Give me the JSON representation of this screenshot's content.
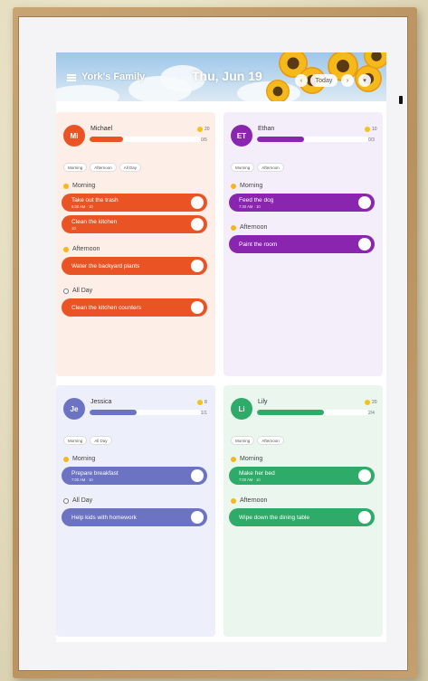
{
  "header": {
    "family_name": "York's Family",
    "date": "Thu, Jun 19",
    "today_label": "Today",
    "prev_icon": "chevron-left-icon",
    "next_icon": "chevron-right-icon",
    "filter_icon": "filter-icon",
    "menu_icon": "menu-icon"
  },
  "members": [
    {
      "initials": "Mi",
      "name": "Michael",
      "color": "#ea5424",
      "bg": "#fdeee8",
      "progress": 0.3,
      "stars": "20",
      "ratio": "0/5",
      "chips": [
        "Morning",
        "Afternoon",
        "All Day"
      ],
      "sections": [
        {
          "label": "Morning",
          "icon": "sun-icon",
          "tasks": [
            {
              "title": "Take out the trash",
              "meta": "6:00 AM  ·  10"
            },
            {
              "title": "Clean the kitchen",
              "meta": "10"
            }
          ]
        },
        {
          "label": "Afternoon",
          "icon": "sun-icon",
          "tasks": [
            {
              "title": "Water the backyard plants",
              "meta": ""
            }
          ]
        },
        {
          "label": "All Day",
          "icon": "clock-icon",
          "tasks": [
            {
              "title": "Clean the kitchen counters",
              "meta": ""
            }
          ]
        }
      ]
    },
    {
      "initials": "ET",
      "name": "Ethan",
      "color": "#8a25b0",
      "bg": "#f4eefb",
      "progress": 0.42,
      "stars": "10",
      "ratio": "0/3",
      "chips": [
        "Morning",
        "Afternoon"
      ],
      "sections": [
        {
          "label": "Morning",
          "icon": "sun-icon",
          "tasks": [
            {
              "title": "Feed the dog",
              "meta": "7:30 AM  ·  10"
            }
          ]
        },
        {
          "label": "Afternoon",
          "icon": "sun-icon",
          "tasks": [
            {
              "title": "Paint the room",
              "meta": ""
            }
          ]
        }
      ]
    },
    {
      "initials": "Je",
      "name": "Jessica",
      "color": "#6b73c2",
      "bg": "#edf0fa",
      "progress": 0.42,
      "stars": "8",
      "ratio": "1/1",
      "chips": [
        "Morning",
        "All Day"
      ],
      "sections": [
        {
          "label": "Morning",
          "icon": "sun-icon",
          "tasks": [
            {
              "title": "Prepare breakfast",
              "meta": "7:00 AM  ·  10"
            }
          ]
        },
        {
          "label": "All Day",
          "icon": "clock-icon",
          "tasks": [
            {
              "title": "Help kids with homework",
              "meta": ""
            }
          ]
        }
      ]
    },
    {
      "initials": "Li",
      "name": "Lily",
      "color": "#2eab68",
      "bg": "#eaf6ee",
      "progress": 0.6,
      "stars": "20",
      "ratio": "2/4",
      "chips": [
        "Morning",
        "Afternoon"
      ],
      "sections": [
        {
          "label": "Morning",
          "icon": "sun-icon",
          "tasks": [
            {
              "title": "Make her bed",
              "meta": "7:00 AM  ·  10"
            }
          ]
        },
        {
          "label": "Afternoon",
          "icon": "sun-icon",
          "tasks": [
            {
              "title": "Wipe down the dining table",
              "meta": ""
            }
          ]
        }
      ]
    }
  ]
}
